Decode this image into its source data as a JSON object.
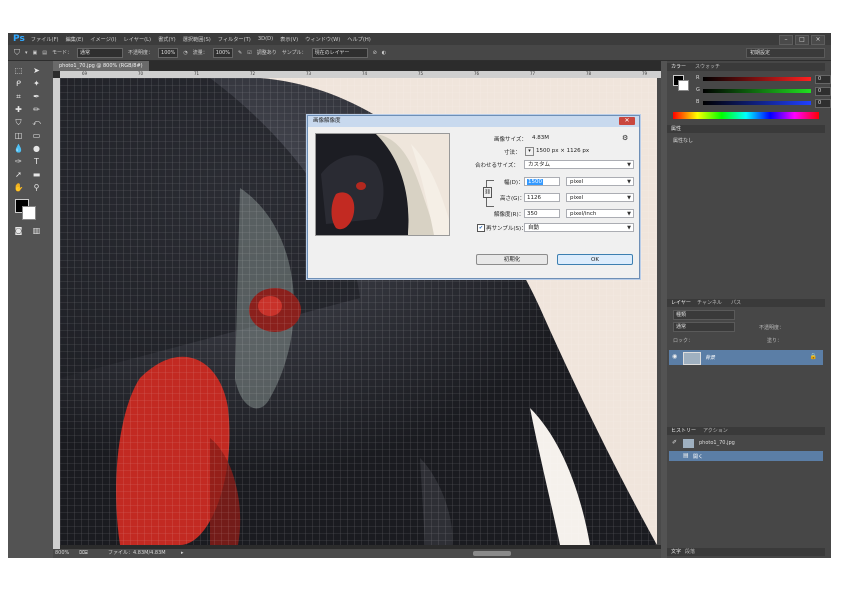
{
  "app": {
    "logo": "Ps"
  },
  "menu": [
    "ファイル(F)",
    "編集(E)",
    "イメージ(I)",
    "レイヤー(L)",
    "書式(Y)",
    "選択範囲(S)",
    "フィルター(T)",
    "3D(D)",
    "表示(V)",
    "ウィンドウ(W)",
    "ヘルプ(H)"
  ],
  "window_buttons": {
    "minimize": "–",
    "maximize": "□",
    "close": "×"
  },
  "options": {
    "mode_label": "モード：",
    "mode_value": "通常",
    "opacity_label": "不透明度：",
    "opacity_value": "100%",
    "flow_label": "流量：",
    "flow_value": "100%",
    "align_label": "調整あり",
    "sample_label": "サンプル：",
    "sample_value": "現在のレイヤー",
    "workspace": "初期設定"
  },
  "document": {
    "tab": "photo1_70.jpg @ 800% (RGB/8#)",
    "ruler_ticks": [
      "69",
      "70",
      "71",
      "72",
      "73",
      "74",
      "75",
      "76",
      "77",
      "78",
      "79"
    ],
    "status_zoom": "800%",
    "status_file": "ファイル：4.83M/4.83M"
  },
  "dialog": {
    "title": "画像解像度",
    "image_size_label": "画像サイズ：",
    "image_size_value": "4.83M",
    "dimensions_label": "寸法：",
    "dimensions_value": "1500 px × 1126 px",
    "fit_label": "合わせるサイズ：",
    "fit_value": "カスタム",
    "width_label": "幅(D)：",
    "width_value": "1500",
    "width_unit": "pixel",
    "height_label": "高さ(G)：",
    "height_value": "1126",
    "height_unit": "pixel",
    "resolution_label": "解像度(R)：",
    "resolution_value": "350",
    "resolution_unit": "pixel/inch",
    "resample_label": "再サンプル(S)：",
    "resample_value": "自動",
    "resample_checked": true,
    "cancel_label": "初期化",
    "ok_label": "OK"
  },
  "panels": {
    "color_tabs": [
      "カラー",
      "スウォッチ"
    ],
    "color_channels": [
      {
        "label": "R",
        "value": "0",
        "color": "#e03030"
      },
      {
        "label": "G",
        "value": "0",
        "color": "#30b030"
      },
      {
        "label": "B",
        "value": "0",
        "color": "#3050e0"
      }
    ],
    "properties_tab": "属性",
    "properties_text": "属性なし",
    "layers_tabs": [
      "レイヤー",
      "チャンネル",
      "パス"
    ],
    "layers_kind": "種類",
    "layers_blend": "通常",
    "layers_opacity": "不透明度：",
    "layers_lock": "ロック：",
    "layers_fill": "塗り：",
    "layer_name": "背景",
    "history_tabs": [
      "ヒストリー",
      "アクション"
    ],
    "history_items": [
      "photo1_70.jpg",
      "開く"
    ],
    "bottom_tabs": [
      "文字",
      "段落"
    ]
  },
  "colors": {
    "accent": "#31a8ff",
    "photo_bg": "#f0e5dc",
    "bird_dark": "#1c1d23",
    "beak": "#c22a22"
  }
}
